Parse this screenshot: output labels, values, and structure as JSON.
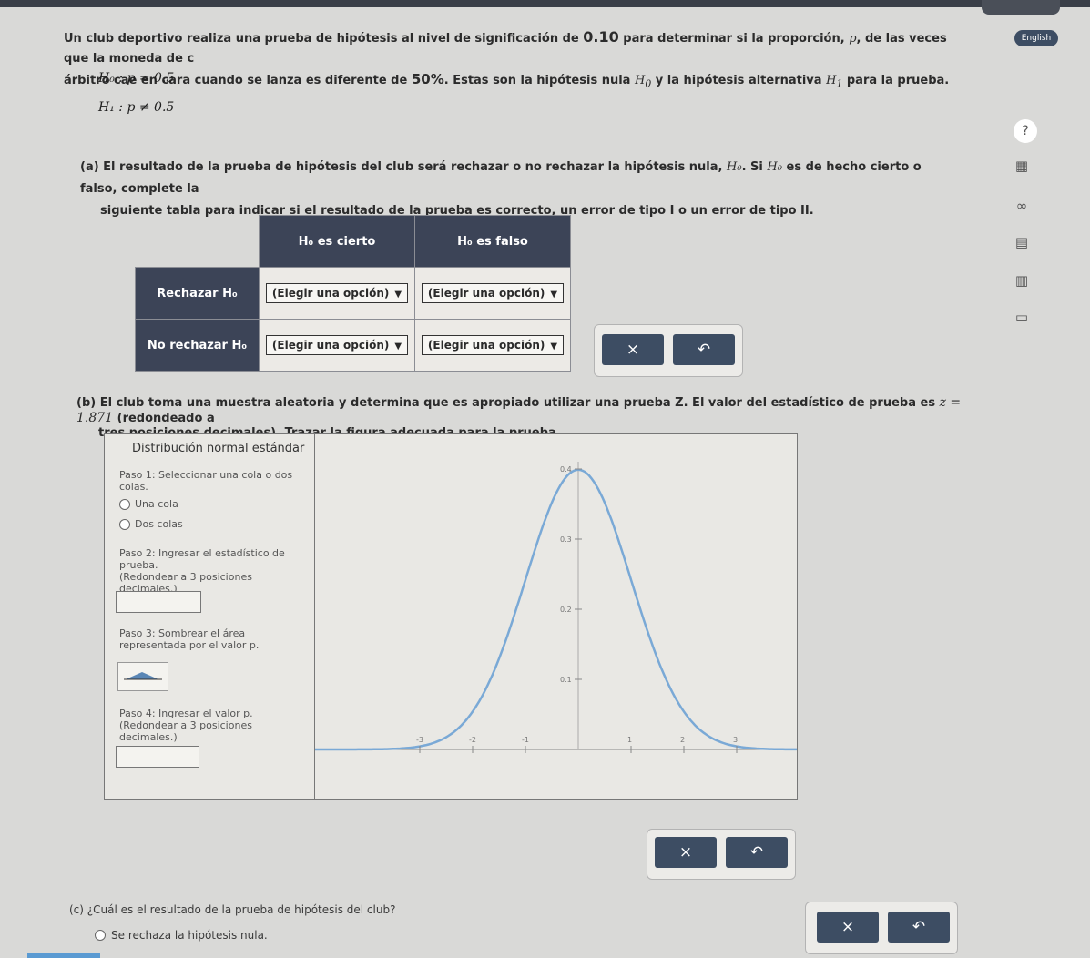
{
  "topbar": {},
  "intro": {
    "part1": "Un club deportivo realiza una prueba de hipótesis al nivel de significación de",
    "alpha": "0.10",
    "part2": "para determinar si la proporción,",
    "p": "p",
    "part3": ", de las veces que la moneda de c",
    "part4": "árbitro cae en cara cuando se lanza es diferente de",
    "percent": "50%",
    "part5": ". Estas son la hipótesis nula",
    "h0": "H",
    "h0sub": "0",
    "part6": "y la hipótesis alternativa",
    "h1": "H",
    "h1sub": "1",
    "part7": "para la prueba."
  },
  "hypotheses": {
    "null": "H₀ : p = 0.5",
    "alt": "H₁ : p ≠ 0.5"
  },
  "part_a": {
    "text1": "(a) El resultado de la prueba de hipótesis del club será rechazar o no rechazar la hipótesis nula,",
    "h0": "H₀",
    "text2": ". Si",
    "h0b": "H₀",
    "text3": "es de hecho cierto o falso, complete la",
    "text4": "siguiente tabla para indicar si el resultado de la prueba es correcto, un error de tipo I o un error de tipo II."
  },
  "table": {
    "col1": "H₀ es cierto",
    "col2": "H₀ es falso",
    "row1": "Rechazar H₀",
    "row2": "No rechazar H₀",
    "select": "(Elegir una opción)"
  },
  "buttons": {
    "clear": "×",
    "undo": "↶"
  },
  "part_b": {
    "text1": "(b) El club toma una muestra aleatoria y determina que es apropiado utilizar una prueba Z. El valor del estadístico de prueba es",
    "stat": "z = 1.871",
    "text2": "(redondeado a",
    "text3": "tres posiciones decimales). Trazar la figura adecuada para la prueba."
  },
  "tool": {
    "title": "Distribución normal estándar",
    "step1": "Paso 1: Seleccionar una cola o dos colas.",
    "opt1": "Una cola",
    "opt2": "Dos colas",
    "step2": "Paso 2: Ingresar el estadístico de prueba.",
    "step2b": "(Redondear a 3 posiciones decimales.)",
    "step3": "Paso 3: Sombrear el área representada por el valor p.",
    "step4": "Paso 4: Ingresar el valor p.",
    "step4b": "(Redondear a 3 posiciones decimales.)",
    "yticks": [
      "0.4",
      "0.3",
      "0.2",
      "0.1"
    ],
    "xticks": [
      "-3",
      "-2",
      "-1",
      "1",
      "2",
      "3"
    ]
  },
  "sidebar": {
    "english": "English",
    "help": "?"
  },
  "part_c": {
    "question": "(c) ¿Cuál es el resultado de la prueba de hipótesis del club?",
    "option1": "Se rechaza la hipótesis nula."
  },
  "colors": {
    "header_bg": "#3c4457",
    "button_bg": "#3d4d63",
    "curve": "#7aa9d6"
  }
}
